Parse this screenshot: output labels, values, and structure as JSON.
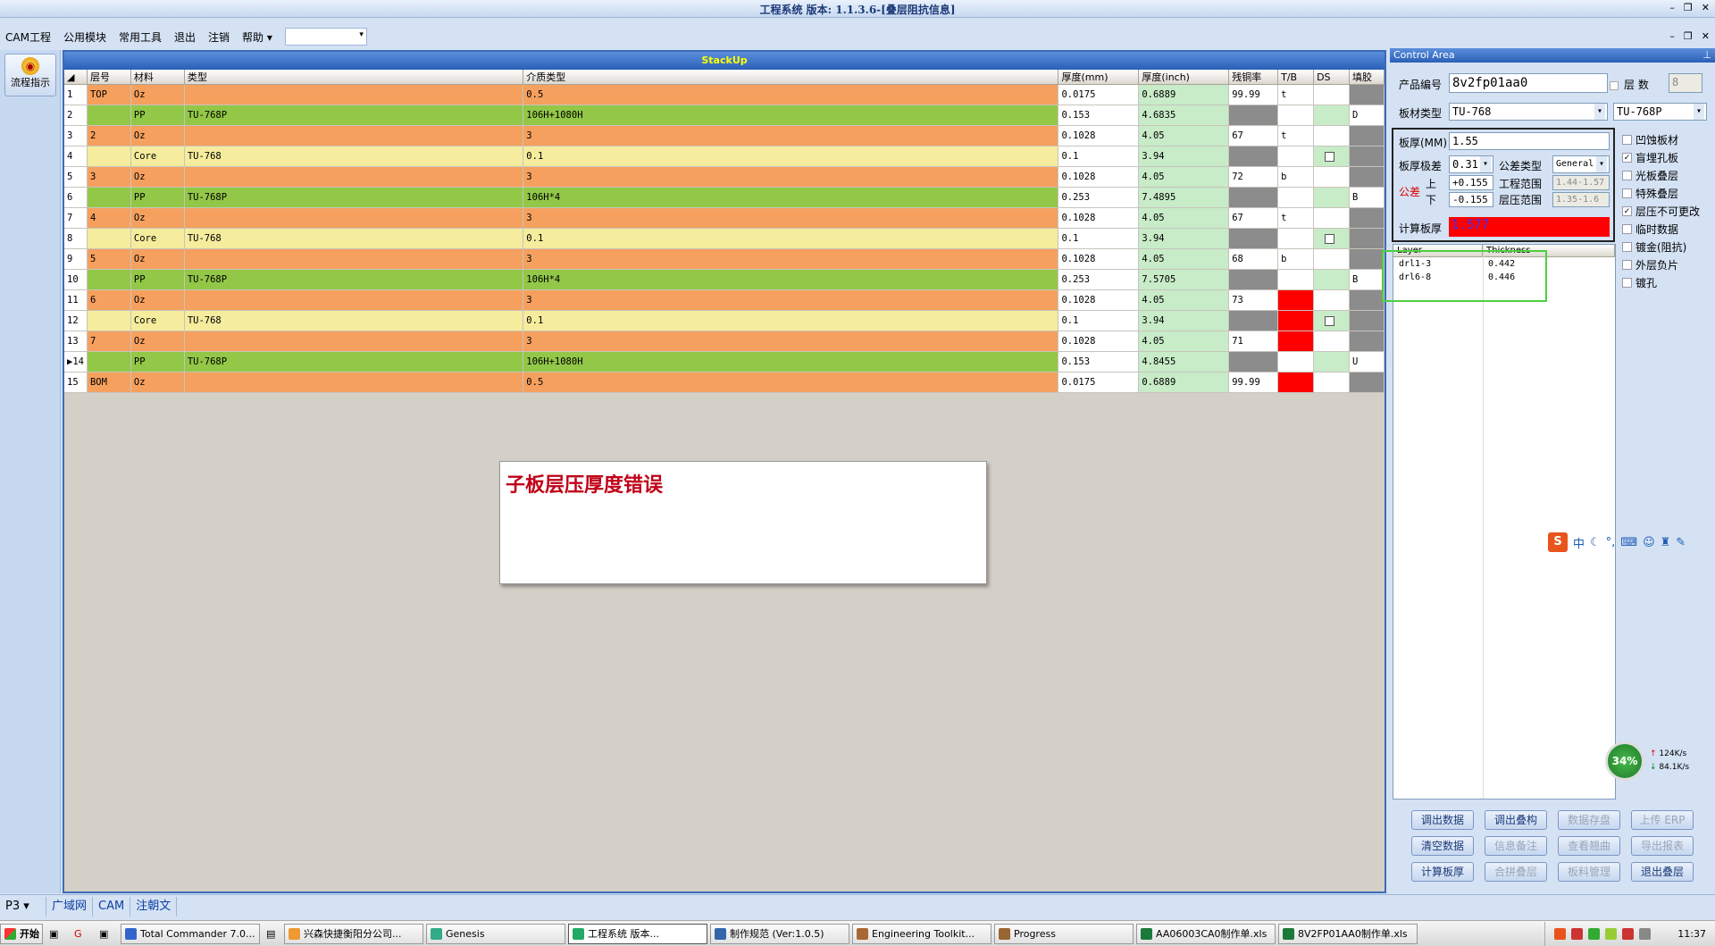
{
  "app": {
    "title": "工程系统 版本: 1.1.3.6-[叠层阻抗信息]"
  },
  "menu": [
    "CAM工程",
    "公用模块",
    "常用工具",
    "退出",
    "注销",
    "帮助"
  ],
  "left": {
    "flow_button": "流程指示"
  },
  "grid": {
    "title": "StackUp",
    "headers": [
      "",
      "层号",
      "材料",
      "类型",
      "介质类型",
      "厚度(mm)",
      "厚度(inch)",
      "残铜率",
      "T/B",
      "DS",
      "填胶"
    ],
    "rows": [
      {
        "n": "1",
        "layer": "TOP",
        "mat": "Oz",
        "type": "",
        "diel": "0.5",
        "mm": "0.0175",
        "inch": "0.6889",
        "cu": "99.99",
        "tb": "t",
        "ds": "",
        "fill": ""
      },
      {
        "n": "2",
        "layer": "",
        "mat": "PP",
        "type": "TU-768P",
        "diel": "106H+1080H",
        "mm": "0.153",
        "inch": "4.6835",
        "cu": "",
        "tb": "",
        "ds": "",
        "fill": "D"
      },
      {
        "n": "3",
        "layer": "2",
        "mat": "Oz",
        "type": "",
        "diel": "3",
        "mm": "0.1028",
        "inch": "4.05",
        "cu": "67",
        "tb": "t",
        "ds": "",
        "fill": ""
      },
      {
        "n": "4",
        "layer": "",
        "mat": "Core",
        "type": "TU-768",
        "diel": "0.1",
        "mm": "0.1",
        "inch": "3.94",
        "cu": "",
        "tb": "",
        "ds": "",
        "fill": ""
      },
      {
        "n": "5",
        "layer": "3",
        "mat": "Oz",
        "type": "",
        "diel": "3",
        "mm": "0.1028",
        "inch": "4.05",
        "cu": "72",
        "tb": "b",
        "ds": "",
        "fill": ""
      },
      {
        "n": "6",
        "layer": "",
        "mat": "PP",
        "type": "TU-768P",
        "diel": "106H*4",
        "mm": "0.253",
        "inch": "7.4895",
        "cu": "",
        "tb": "",
        "ds": "",
        "fill": "B"
      },
      {
        "n": "7",
        "layer": "4",
        "mat": "Oz",
        "type": "",
        "diel": "3",
        "mm": "0.1028",
        "inch": "4.05",
        "cu": "67",
        "tb": "t",
        "ds": "",
        "fill": ""
      },
      {
        "n": "8",
        "layer": "",
        "mat": "Core",
        "type": "TU-768",
        "diel": "0.1",
        "mm": "0.1",
        "inch": "3.94",
        "cu": "",
        "tb": "",
        "ds": "",
        "fill": ""
      },
      {
        "n": "9",
        "layer": "5",
        "mat": "Oz",
        "type": "",
        "diel": "3",
        "mm": "0.1028",
        "inch": "4.05",
        "cu": "68",
        "tb": "b",
        "ds": "",
        "fill": ""
      },
      {
        "n": "10",
        "layer": "",
        "mat": "PP",
        "type": "TU-768P",
        "diel": "106H*4",
        "mm": "0.253",
        "inch": "7.5705",
        "cu": "",
        "tb": "",
        "ds": "",
        "fill": "B"
      },
      {
        "n": "11",
        "layer": "6",
        "mat": "Oz",
        "type": "",
        "diel": "3",
        "mm": "0.1028",
        "inch": "4.05",
        "cu": "73",
        "tb": "",
        "ds": "",
        "fill": ""
      },
      {
        "n": "12",
        "layer": "",
        "mat": "Core",
        "type": "TU-768",
        "diel": "0.1",
        "mm": "0.1",
        "inch": "3.94",
        "cu": "",
        "tb": "",
        "ds": "",
        "fill": ""
      },
      {
        "n": "13",
        "layer": "7",
        "mat": "Oz",
        "type": "",
        "diel": "3",
        "mm": "0.1028",
        "inch": "4.05",
        "cu": "71",
        "tb": "",
        "ds": "",
        "fill": ""
      },
      {
        "n": "▶14",
        "layer": "",
        "mat": "PP",
        "type": "TU-768P",
        "diel": "106H+1080H",
        "mm": "0.153",
        "inch": "4.8455",
        "cu": "",
        "tb": "",
        "ds": "",
        "fill": "U"
      },
      {
        "n": "15",
        "layer": "BOM",
        "mat": "Oz",
        "type": "",
        "diel": "0.5",
        "mm": "0.0175",
        "inch": "0.6889",
        "cu": "99.99",
        "tb": "",
        "ds": "",
        "fill": ""
      }
    ]
  },
  "error": {
    "message": "子板层压厚度错误"
  },
  "control": {
    "title": "Control Area",
    "product_label": "产品编号",
    "product_value": "8v2fp01aa0",
    "layers_label": "层  数",
    "layers_value": "8",
    "material_label": "板材类型",
    "material_value": "TU-768",
    "material2_value": "TU-768P",
    "thickness_label": "板厚(MM)",
    "thickness_value": "1.55",
    "tol_label": "板厚极差",
    "tol_value": "0.31",
    "toltype_label": "公差类型",
    "toltype_value": "General",
    "gongcha_label": "公差",
    "upper_label": "上",
    "lower_label": "下",
    "upper_value": "+0.155",
    "lower_value": "-0.155",
    "eng_range_label": "工程范围",
    "eng_range_value": "1.44-1.57",
    "press_range_label": "层压范围",
    "press_range_value": "1.35-1.6",
    "calc_label": "计算板厚",
    "calc_value": "1.577",
    "list_headers": [
      "Layer",
      "Thickness"
    ],
    "list_rows": [
      {
        "layer": "drl1-3",
        "thk": "0.442"
      },
      {
        "layer": "drl6-8",
        "thk": "0.446"
      }
    ],
    "options": [
      "凹蚀板材",
      "盲埋孔板",
      "光板叠层",
      "特殊叠层",
      "层压不可更改",
      "临时数据",
      "镀金(阻抗)",
      "外层负片",
      "镀孔"
    ],
    "buttons": [
      "调出数据",
      "调出叠构",
      "数据存盘",
      "上传 ERP",
      "清空数据",
      "信息备注",
      "查看翘曲",
      "导出报表",
      "计算板厚",
      "合拼叠层",
      "板料管理",
      "退出叠层"
    ]
  },
  "statusbar": [
    "P3",
    "广域网",
    "CAM",
    "注朝文"
  ],
  "taskbar": {
    "start": "开始",
    "tasks": [
      "Total Commander 7.0...",
      "兴森快捷衡阳分公司...",
      "Genesis",
      "工程系统   版本...",
      "制作规范 (Ver:1.0.5)",
      "Engineering Toolkit...",
      "Progress",
      "AA06003CA0制作单.xls",
      "8V2FP01AA0制作单.xls"
    ],
    "clock": "11:37"
  },
  "netmeter": {
    "percent": "34%",
    "up": "124K/s",
    "down": "84.1K/s"
  },
  "colors": {
    "oz": "#f5a05e",
    "pp": "#92c747",
    "core": "#f5ec9d",
    "calc_bg": "#ff0000"
  }
}
